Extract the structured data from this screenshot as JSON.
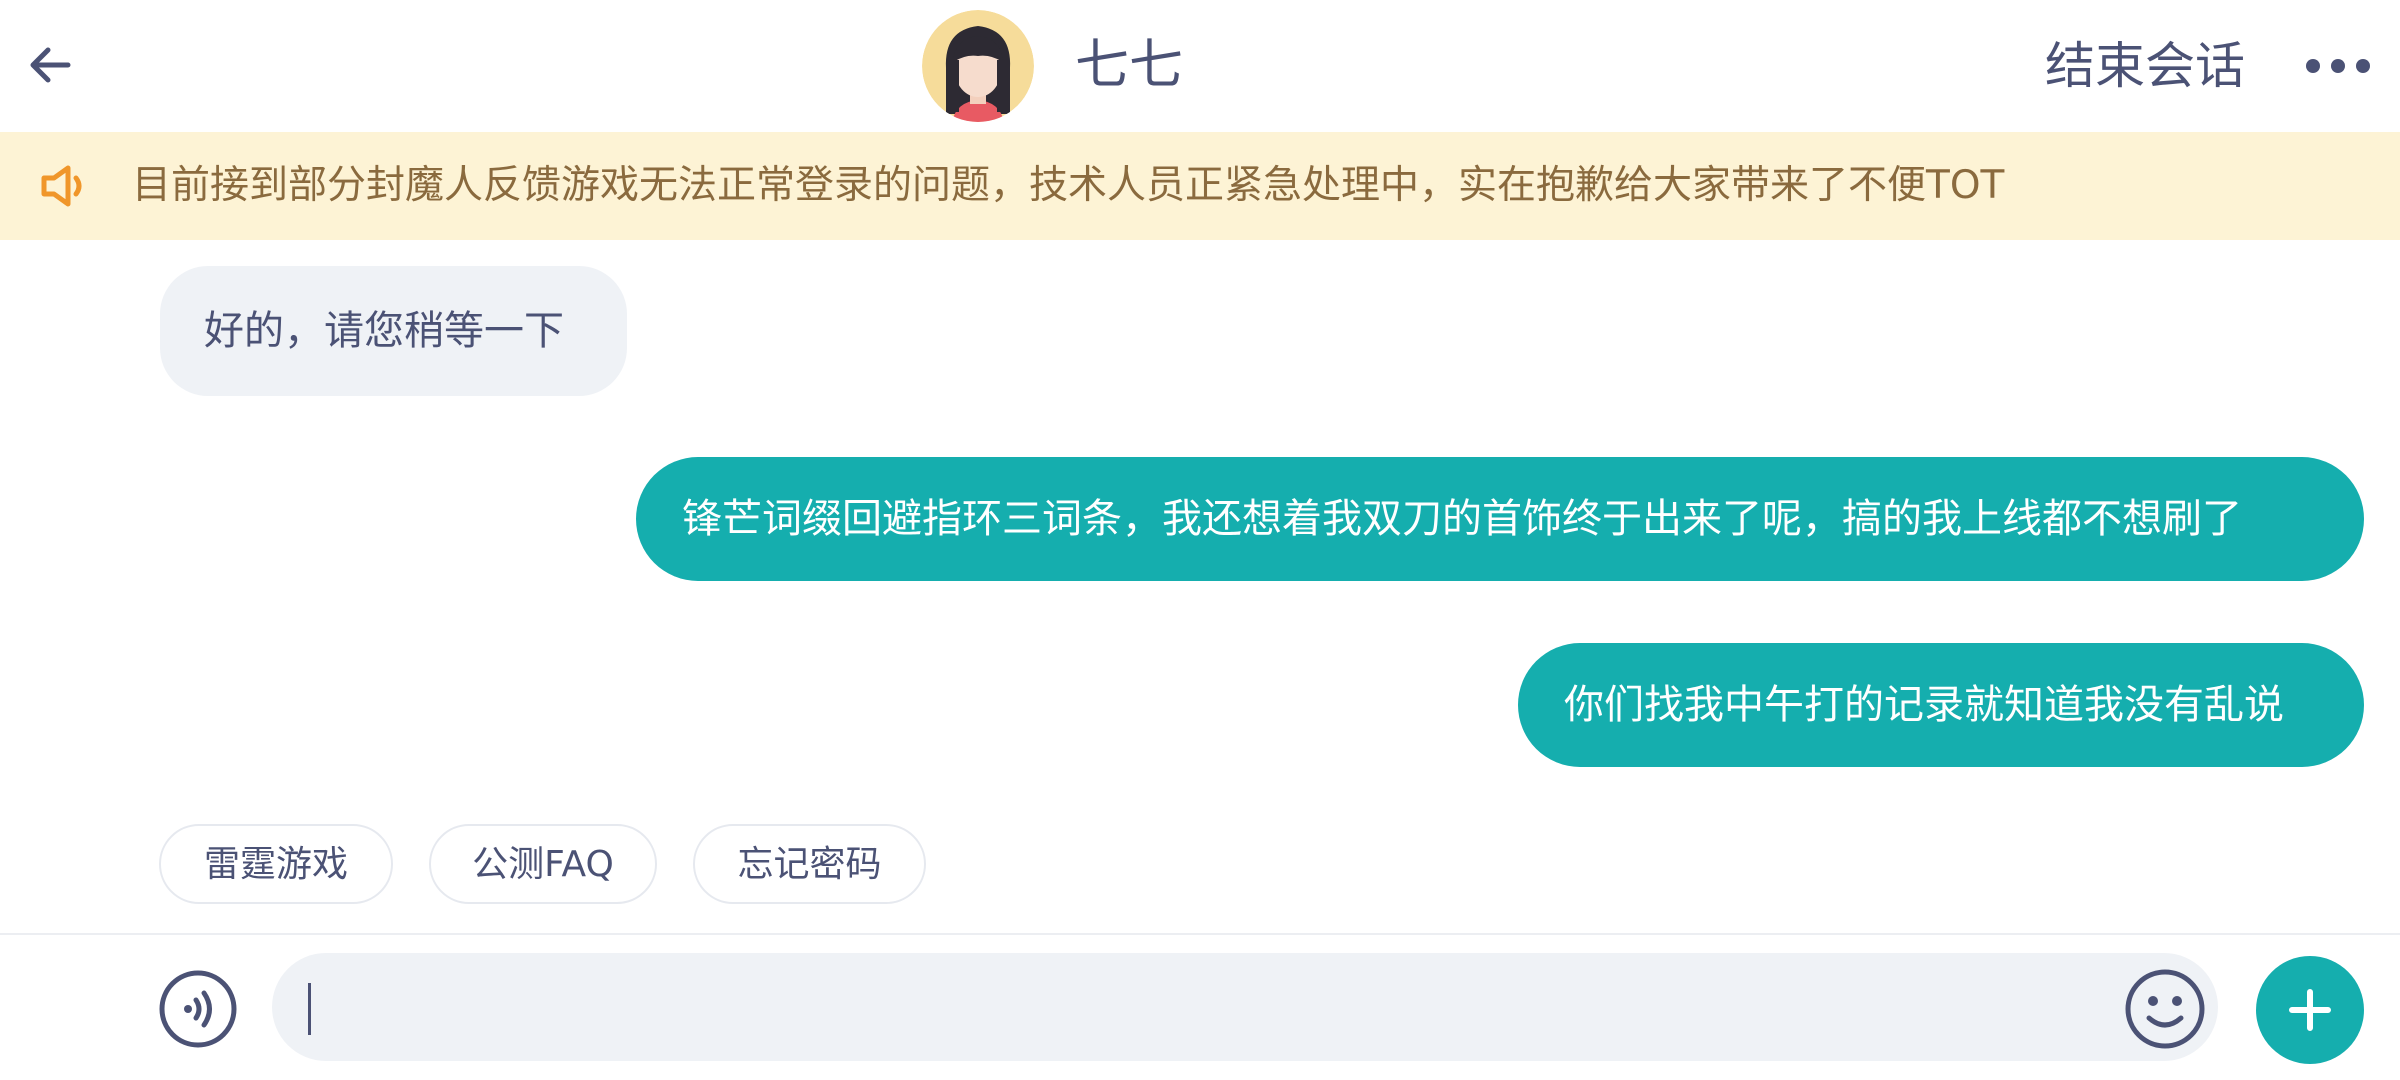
{
  "header": {
    "agent_name": "七七",
    "end_session_label": "结束会话",
    "back_icon": "arrow-left-icon",
    "more_icon": "more-horizontal-icon",
    "avatar": "agent-avatar"
  },
  "notice": {
    "icon": "speaker-icon",
    "text": "目前接到部分封魔人反馈游戏无法正常登录的问题，技术人员正紧急处理中，实在抱歉给大家带来了不便TOT",
    "background_color": "#fdf3d5",
    "text_color": "#8a6a3e",
    "icon_color": "#f0962a"
  },
  "messages": [
    {
      "sender": "agent",
      "text": "好的，请您稍等一下"
    },
    {
      "sender": "user",
      "text": "锋芒词缀回避指环三词条，我还想着我双刀的首饰终于出来了呢，搞的我上线都不想刷了"
    },
    {
      "sender": "user",
      "text": "你们找我中午打的记录就知道我没有乱说"
    }
  ],
  "quick_replies": [
    "雷霆游戏",
    "公测FAQ",
    "忘记密码"
  ],
  "input": {
    "value": "",
    "placeholder": "",
    "voice_icon": "voice-icon",
    "emoji_icon": "emoji-icon",
    "plus_icon": "plus-icon"
  },
  "colors": {
    "accent": "#15aeae",
    "text_primary": "#4b5275",
    "agent_bubble": "#eff2f6"
  }
}
